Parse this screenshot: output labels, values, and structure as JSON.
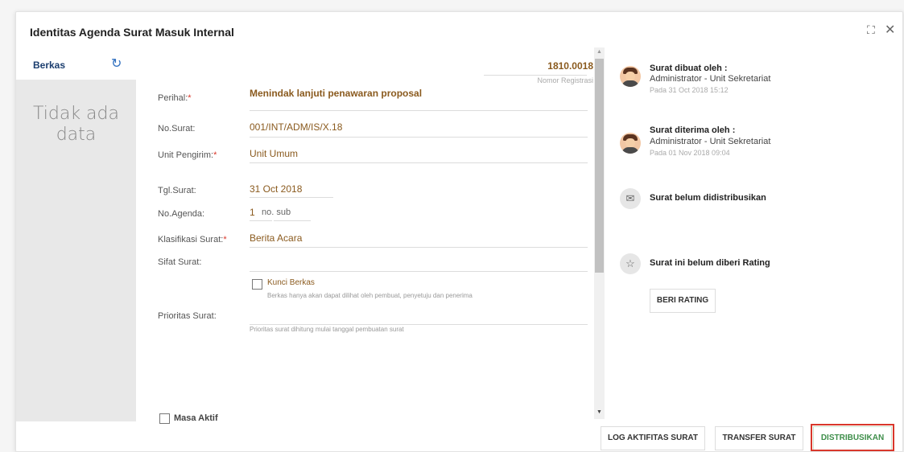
{
  "header": {
    "title": "Identitas Agenda Surat Masuk Internal"
  },
  "berkas": {
    "label": "Berkas",
    "empty_line1": "Tidak ada",
    "empty_line2": "data"
  },
  "registration": {
    "number": "1810.0018",
    "label": "Nomor Registrasi"
  },
  "form": {
    "perihal_label": "Perihal:",
    "perihal_value": "Menindak lanjuti penawaran proposal",
    "nosurat_label": "No.Surat:",
    "nosurat_value": "001/INT/ADM/IS/X.18",
    "unit_label": "Unit Pengirim:",
    "unit_value": "Unit Umum",
    "tgl_label": "Tgl.Surat:",
    "tgl_value": "31 Oct 2018",
    "noagenda_label": "No.Agenda:",
    "noagenda_value": "1",
    "nosub_placeholder": "no. sub",
    "klasifikasi_label": "Klasifikasi Surat:",
    "klasifikasi_value": "Berita Acara",
    "sifat_label": "Sifat Surat:",
    "kunci_label": "Kunci Berkas",
    "kunci_desc": "Berkas hanya akan dapat dilihat oleh pembuat, penyetuju dan penerima",
    "prioritas_label": "Prioritas Surat:",
    "prioritas_desc": "Prioritas surat dihitung mulai tanggal pembuatan surat",
    "masa_label": "Masa Aktif",
    "required_mark": "*"
  },
  "activity": [
    {
      "title": "Surat dibuat oleh :",
      "who": "Administrator - Unit Sekretariat",
      "date": "Pada 31 Oct 2018 15:12"
    },
    {
      "title": "Surat diterima oleh :",
      "who": "Administrator - Unit Sekretariat",
      "date": "Pada 01 Nov 2018 09:04"
    },
    {
      "title": "Surat belum didistribusikan"
    },
    {
      "title": "Surat ini belum diberi Rating"
    }
  ],
  "buttons": {
    "rating": "BERI RATING",
    "log": "LOG AKTIFITAS SURAT",
    "transfer": "TRANSFER SURAT",
    "distribusi": "DISTRIBUSIKAN"
  },
  "icons": {
    "expand": "expand-icon",
    "close": "close-icon",
    "refresh": "refresh-icon",
    "mail": "mail-icon",
    "star": "star-icon"
  },
  "colors": {
    "value_text": "#8a5a1e",
    "required": "#d9372b",
    "distribute": "#3e8e4a",
    "highlight": "#d9372b"
  }
}
